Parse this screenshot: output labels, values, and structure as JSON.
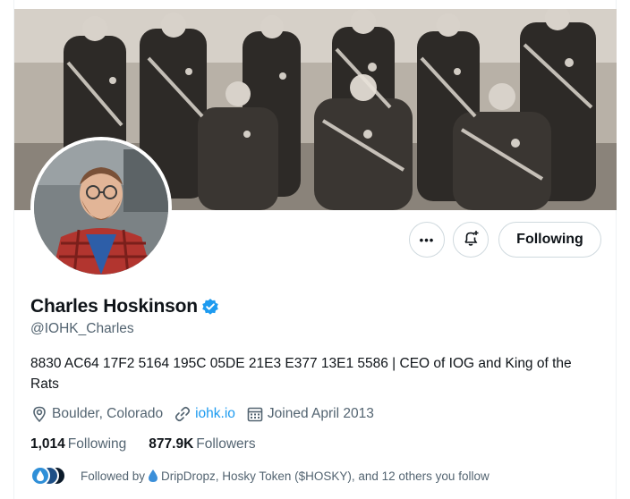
{
  "profile": {
    "display_name": "Charles Hoskinson",
    "handle": "@IOHK_Charles",
    "bio": "8830 AC64 17F2 5164 195C 05DE 21E3 E377 13E1 5586 | CEO of IOG and King of the Rats",
    "location": "Boulder, Colorado",
    "website": "iohk.io",
    "joined": "Joined April 2013",
    "verified": true
  },
  "actions": {
    "more_label": "•••",
    "following_label": "Following"
  },
  "stats": {
    "following_count": "1,014",
    "following_label": "Following",
    "followers_count": "877.9K",
    "followers_label": "Followers"
  },
  "followed_by": {
    "prefix": "Followed by",
    "names": "DripDropz, Hosky Token ($HOSKY), and 12 others you follow"
  },
  "icons": {
    "verified": "verified-badge-icon",
    "location": "location-pin-icon",
    "link": "link-icon",
    "calendar": "calendar-icon",
    "more": "more-icon",
    "notify": "bell-plus-icon",
    "drop": "water-drop-icon"
  },
  "colors": {
    "accent": "#1d9bf0",
    "text_primary": "#0f1419",
    "text_secondary": "#536471",
    "border": "#cfd9de"
  }
}
